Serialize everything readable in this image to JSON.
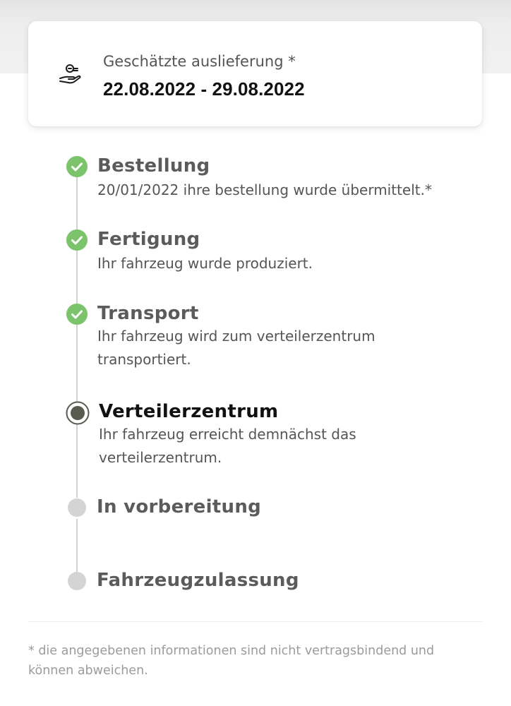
{
  "delivery": {
    "icon": "hand-delivery-icon",
    "label": "Geschätzte auslieferung *",
    "date_range": "22.08.2022 - 29.08.2022"
  },
  "timeline": {
    "steps": [
      {
        "title": "Bestellung",
        "description": "20/01/2022 ihre bestellung wurde übermittelt.*",
        "status": "completed"
      },
      {
        "title": "Fertigung",
        "description": "Ihr fahrzeug wurde produziert.",
        "status": "completed"
      },
      {
        "title": "Transport",
        "description": "Ihr fahrzeug wird zum verteilerzentrum transportiert.",
        "status": "completed"
      },
      {
        "title": "Verteilerzentrum",
        "description": "Ihr fahrzeug erreicht demnächst das verteilerzentrum.",
        "status": "current"
      },
      {
        "title": "In vorbereitung",
        "description": "",
        "status": "pending"
      },
      {
        "title": "Fahrzeugzulassung",
        "description": "",
        "status": "pending"
      }
    ]
  },
  "footnote": "* die angegebenen informationen sind nicht vertragsbindend und können abweichen.",
  "colors": {
    "completed": "#7cc46b",
    "current": "#5a5a4f",
    "pending": "#d4d4d4",
    "line": "#d2d2d2"
  }
}
